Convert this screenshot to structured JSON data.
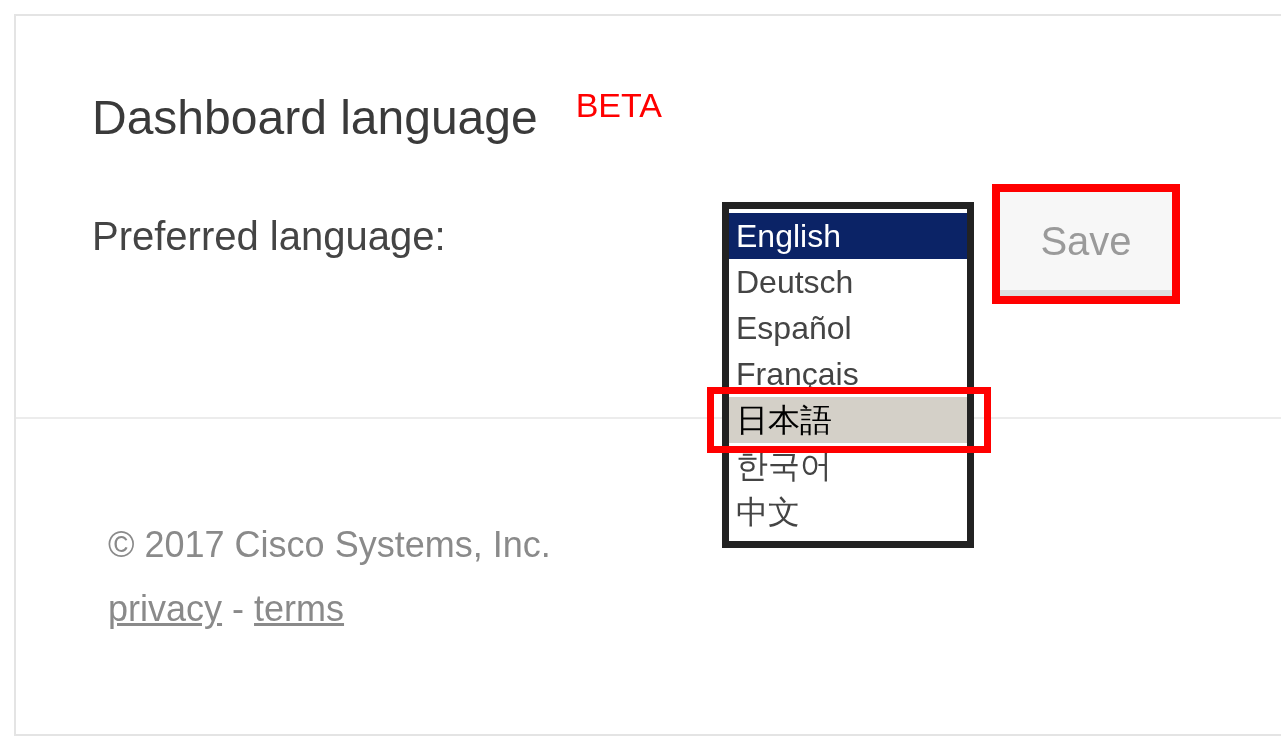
{
  "section": {
    "title": "Dashboard language",
    "badge": "BETA"
  },
  "field": {
    "label": "Preferred language:",
    "options": [
      {
        "label": "English",
        "selected": true,
        "hovered": false,
        "highlighted": false
      },
      {
        "label": "Deutsch",
        "selected": false,
        "hovered": false,
        "highlighted": false
      },
      {
        "label": "Español",
        "selected": false,
        "hovered": false,
        "highlighted": false
      },
      {
        "label": "Français",
        "selected": false,
        "hovered": false,
        "highlighted": false
      },
      {
        "label": "日本語",
        "selected": false,
        "hovered": true,
        "highlighted": true
      },
      {
        "label": "한국어",
        "selected": false,
        "hovered": false,
        "highlighted": false
      },
      {
        "label": "中文",
        "selected": false,
        "hovered": false,
        "highlighted": false
      }
    ]
  },
  "save_button": {
    "label": "Save",
    "highlighted": true
  },
  "footer": {
    "copyright": "© 2017 Cisco Systems, Inc.",
    "links": [
      "privacy",
      "terms"
    ],
    "separator": "-"
  }
}
